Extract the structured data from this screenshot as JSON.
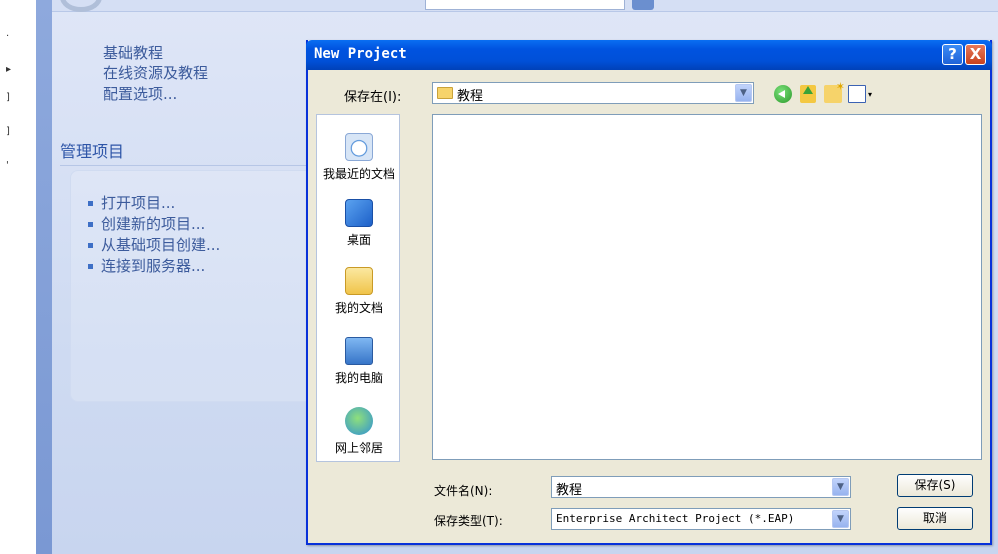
{
  "left_strip": {
    "marks": [
      ".",
      "▸",
      "]",
      "]",
      "'"
    ]
  },
  "start_page": {
    "links": [
      "基础教程",
      "在线资源及教程",
      "配置选项..."
    ],
    "section_title": "管理项目",
    "manage_items": [
      "打开项目...",
      "创建新的项目...",
      "从基础项目创建...",
      "连接到服务器..."
    ]
  },
  "dialog": {
    "title": "New Project",
    "help_button": "?",
    "close_button": "X",
    "save_in_label": "保存在(I):",
    "save_in_value": "教程",
    "places": [
      {
        "label": "我最近的文档",
        "icon": "recent-documents-icon"
      },
      {
        "label": "桌面",
        "icon": "desktop-icon"
      },
      {
        "label": "我的文档",
        "icon": "my-documents-icon"
      },
      {
        "label": "我的电脑",
        "icon": "my-computer-icon"
      },
      {
        "label": "网上邻居",
        "icon": "network-places-icon"
      }
    ],
    "filename_label": "文件名(N):",
    "filename_value": "教程",
    "filetype_label": "保存类型(T):",
    "filetype_value": "Enterprise Architect Project (*.EAP)",
    "save_button": "保存(S)",
    "cancel_button": "取消",
    "combo_arrow": "▼",
    "view_arrow": "▾"
  }
}
